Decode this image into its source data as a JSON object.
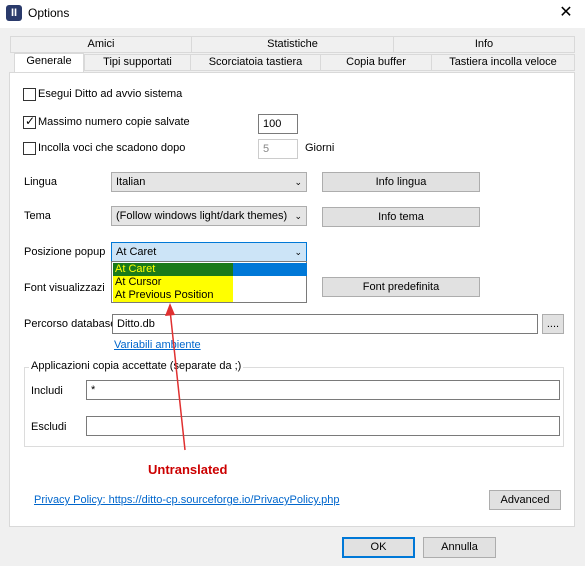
{
  "window": {
    "title": "Options",
    "icon_letter": "II"
  },
  "tabs_row1": [
    "Amici",
    "Statistiche",
    "Info"
  ],
  "tabs_row2": [
    "Generale",
    "Tipi supportati",
    "Scorciatoia tastiera",
    "Copia buffer",
    "Tastiera incolla veloce"
  ],
  "general": {
    "startup_label": "Esegui Ditto ad avvio sistema",
    "max_copies_label": "Massimo numero copie salvate",
    "max_copies_value": "100",
    "expire_label": "Incolla voci che scadono dopo",
    "expire_value": "5",
    "expire_unit": "Giorni",
    "language_label": "Lingua",
    "language_value": "Italian",
    "language_info_button": "Info lingua",
    "theme_label": "Tema",
    "theme_value": "(Follow windows light/dark themes)",
    "theme_info_button": "Info tema",
    "popup_label": "Posizione popup",
    "popup_value": "At Caret",
    "popup_options": [
      "At Caret",
      "At Cursor",
      "At Previous Position"
    ],
    "font_label": "Font visualizzazi",
    "font_default_button": "Font predefinita",
    "db_path_label": "Percorso database",
    "db_path_value": "Ditto.db",
    "browse_button": "....",
    "env_vars_link": "Variabili ambiente",
    "apps_group_title": "Applicazioni copia accettate (separate da ;)",
    "include_label": "Includi",
    "include_value": "*",
    "exclude_label": "Escludi",
    "exclude_value": "",
    "privacy_link": "Privacy Policy: https://ditto-cp.sourceforge.io/PrivacyPolicy.php",
    "advanced_button": "Advanced"
  },
  "annotation": {
    "text": "Untranslated",
    "color": "#cc0000"
  },
  "footer": {
    "ok_button": "OK",
    "cancel_button": "Annulla"
  },
  "colors": {
    "selected_option": "#1a7a1a",
    "highlight": "#ffff00",
    "accent": "#0078d7"
  }
}
